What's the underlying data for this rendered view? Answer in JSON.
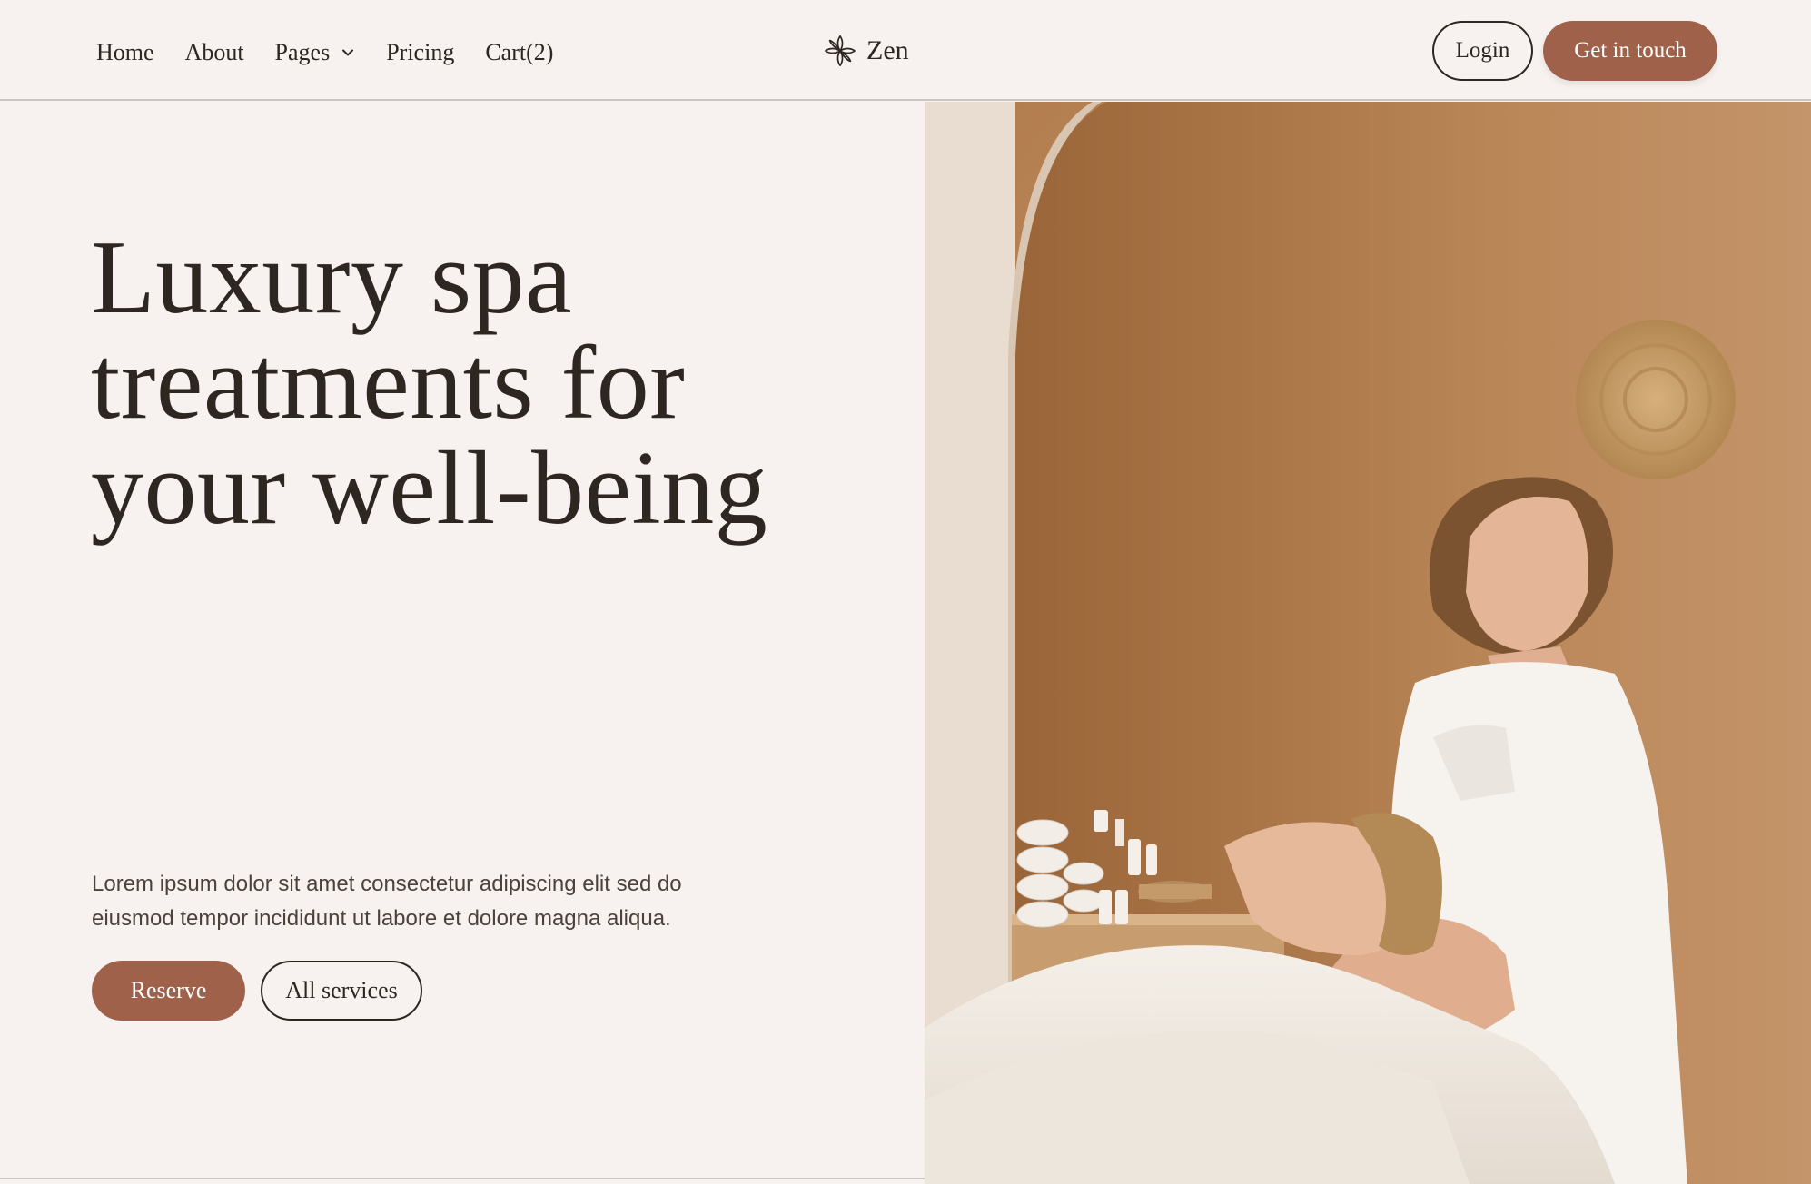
{
  "header": {
    "nav": [
      {
        "label": "Home"
      },
      {
        "label": "About"
      },
      {
        "label": "Pages"
      },
      {
        "label": "Pricing"
      },
      {
        "label": "Cart(2)"
      }
    ],
    "logo_text": "Zen",
    "login_label": "Login",
    "cta_label": "Get in touch"
  },
  "hero": {
    "title_lines": [
      "Luxury spa",
      "treatments for",
      "your well-being"
    ],
    "description_lines": [
      "Lorem ipsum dolor sit amet consectetur adipiscing elit sed do",
      "eiusmod tempor incididunt ut labore et dolore magna aliqua."
    ],
    "reserve_label": "Reserve",
    "services_label": "All services"
  },
  "icons": {
    "logo": "flower-icon",
    "pages_dropdown": "chevron-down-icon"
  },
  "colors": {
    "background": "#f7f2ef",
    "accent": "#a0614b",
    "text": "#2e2620"
  }
}
